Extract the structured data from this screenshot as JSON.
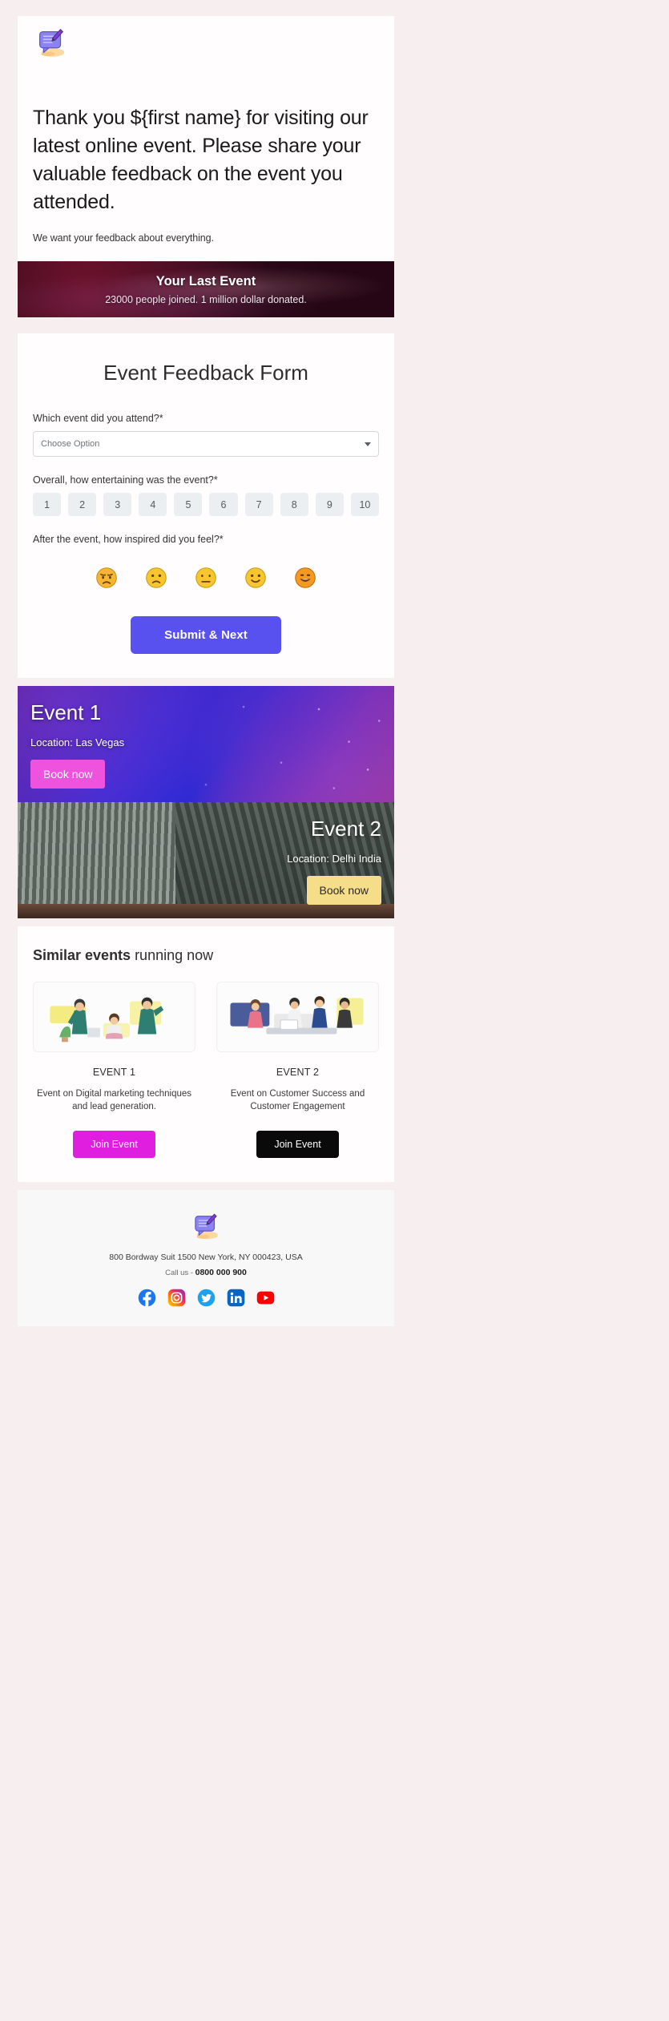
{
  "hero": {
    "logo_icon": "feedback-note-icon",
    "heading": "Thank you ${first name} for visiting our latest online event. Please share your valuable feedback on the event you attended.",
    "subtitle": "We want your feedback about everything."
  },
  "banner": {
    "title": "Your Last Event",
    "subtitle": "23000 people joined. 1 million dollar donated."
  },
  "form": {
    "title": "Event Feedback Form",
    "question_event": "Which event did you attend?*",
    "select_value": "Choose Option",
    "select_options": [
      "Choose Option"
    ],
    "question_entertaining": "Overall, how entertaining was the event?*",
    "scale": [
      "1",
      "2",
      "3",
      "4",
      "5",
      "6",
      "7",
      "8",
      "9",
      "10"
    ],
    "question_inspired": "After the event, how inspired did you feel?*",
    "emojis": [
      "disappointed-face-icon",
      "frowning-face-icon",
      "neutral-face-icon",
      "slightly-smiling-face-icon",
      "grinning-face-icon"
    ],
    "submit_label": "Submit & Next",
    "submit_color": "#5850ef"
  },
  "promos": [
    {
      "title": "Event 1",
      "location": "Location: Las Vegas",
      "button_label": "Book now",
      "button_color": "#ef52dc"
    },
    {
      "title": "Event 2",
      "location": "Location: Delhi India",
      "button_label": "Book now",
      "button_color": "#f6dd8a"
    }
  ],
  "similar": {
    "heading_bold": "Similar events",
    "heading_rest": " running now",
    "cards": [
      {
        "image_icon": "people-presenting-illustration",
        "name": "EVENT 1",
        "description": "Event on Digital marketing techniques and lead generation.",
        "button_label": "Join Event",
        "button_color": "#e01ee0"
      },
      {
        "image_icon": "team-meeting-illustration",
        "name": "EVENT 2",
        "description": "Event on Customer Success and Customer Engagement",
        "button_label": "Join Event",
        "button_color": "#0a0a0a"
      }
    ]
  },
  "footer": {
    "logo_icon": "feedback-note-icon",
    "address": "800 Bordway Suit 1500 New York, NY 000423, USA",
    "call_prefix": "Call us - ",
    "phone": "0800 000 900",
    "social": [
      {
        "name": "facebook-icon"
      },
      {
        "name": "instagram-icon"
      },
      {
        "name": "twitter-icon"
      },
      {
        "name": "linkedin-icon"
      },
      {
        "name": "youtube-icon"
      }
    ]
  }
}
